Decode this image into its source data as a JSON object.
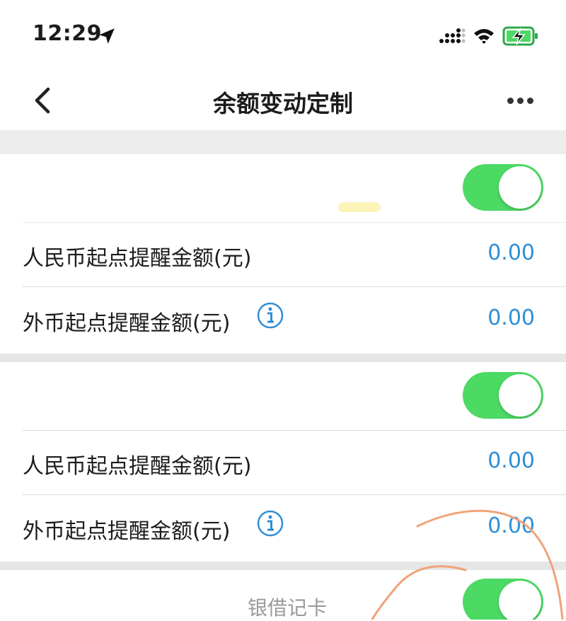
{
  "status_bar": {
    "time": "12:29"
  },
  "nav": {
    "title": "余额变动定制"
  },
  "sections": [
    {
      "toggle_label": "",
      "toggle_on": true,
      "rows": [
        {
          "label": "人民币起点提醒金额(元)",
          "value": "0.00"
        },
        {
          "label": "外币起点提醒金额(元)",
          "value": "0.00",
          "has_info": true
        }
      ]
    },
    {
      "toggle_label": "",
      "toggle_on": true,
      "rows": [
        {
          "label": "人民币起点提醒金额(元)",
          "value": "0.00"
        },
        {
          "label": "外币起点提醒金额(元)",
          "value": "0.00",
          "has_info": true
        }
      ]
    },
    {
      "toggle_label": "银借记卡",
      "toggle_on": true
    }
  ],
  "colors": {
    "accent": "#2e8fd6",
    "toggle_on": "#4cd964",
    "annotation": "#f0a37a"
  },
  "icons": [
    "location-arrow-icon",
    "signal-icon",
    "wifi-icon",
    "battery-charging-icon",
    "back-chevron-icon",
    "more-dots-icon",
    "info-icon"
  ]
}
